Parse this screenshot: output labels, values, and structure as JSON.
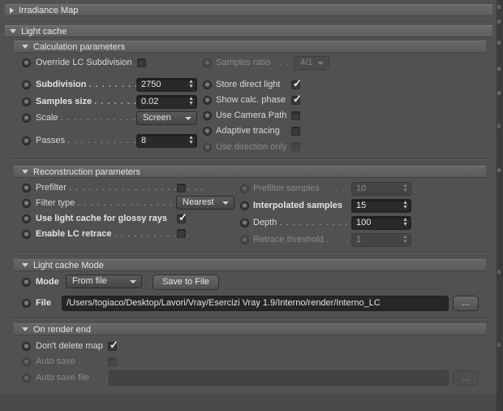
{
  "sections": {
    "irradiance_map": "Irradiance Map",
    "light_cache": "Light cache"
  },
  "calc": {
    "header": "Calculation parameters",
    "override_label": "Override LC Subdivision",
    "samples_ratio_label": "Samples ratio",
    "samples_ratio_value": "4/1",
    "subdivision_label": "Subdivision",
    "subdivision_value": "2750",
    "samples_size_label": "Samples size",
    "samples_size_value": "0.02",
    "scale_label": "Scale",
    "scale_value": "Screen",
    "passes_label": "Passes",
    "passes_value": "8",
    "store_direct_light": "Store direct light",
    "show_calc_phase": "Show calc. phase",
    "use_camera_path": "Use Camera Path",
    "adaptive_tracing": "Adaptive tracing",
    "use_direction_only": "Use direction only"
  },
  "recon": {
    "header": "Reconstruction parameters",
    "prefilter_label": "Prefilter",
    "filter_type_label": "Filter type",
    "filter_type_value": "Nearest",
    "glossy_label": "Use light cache for glossy rays",
    "retrace_label": "Enable LC retrace",
    "prefilter_samples_label": "Prefilter samples",
    "prefilter_samples_value": "10",
    "interp_samples_label": "Interpolated samples",
    "interp_samples_value": "15",
    "depth_label": "Depth",
    "depth_value": "100",
    "retrace_threshold_label": "Retrace threshold",
    "retrace_threshold_value": "1"
  },
  "mode": {
    "header": "Light cache Mode",
    "mode_label": "Mode",
    "mode_value": "From file",
    "save_button": "Save to File",
    "file_label": "File",
    "file_path": "/Users/togiaco/Desktop/Lavori/Vray/Esercizi Vray 1.9/Interno/render/Interno_LC",
    "browse_button": "..."
  },
  "render_end": {
    "header": "On render end",
    "dont_delete_label": "Don't delete map",
    "auto_save_label": "Auto save",
    "auto_save_file_label": "Auto save file",
    "browse_button": "..."
  },
  "right_strip_letters": [
    "e",
    "e",
    "e",
    "e",
    "e",
    "s",
    "e",
    "s",
    "s"
  ],
  "checkmark_glyph": "✓",
  "colors": {
    "panel_bg": "#515151",
    "header_bg": "#626262",
    "field_bg": "#2a2a2a",
    "text": "#d8d8d8"
  }
}
